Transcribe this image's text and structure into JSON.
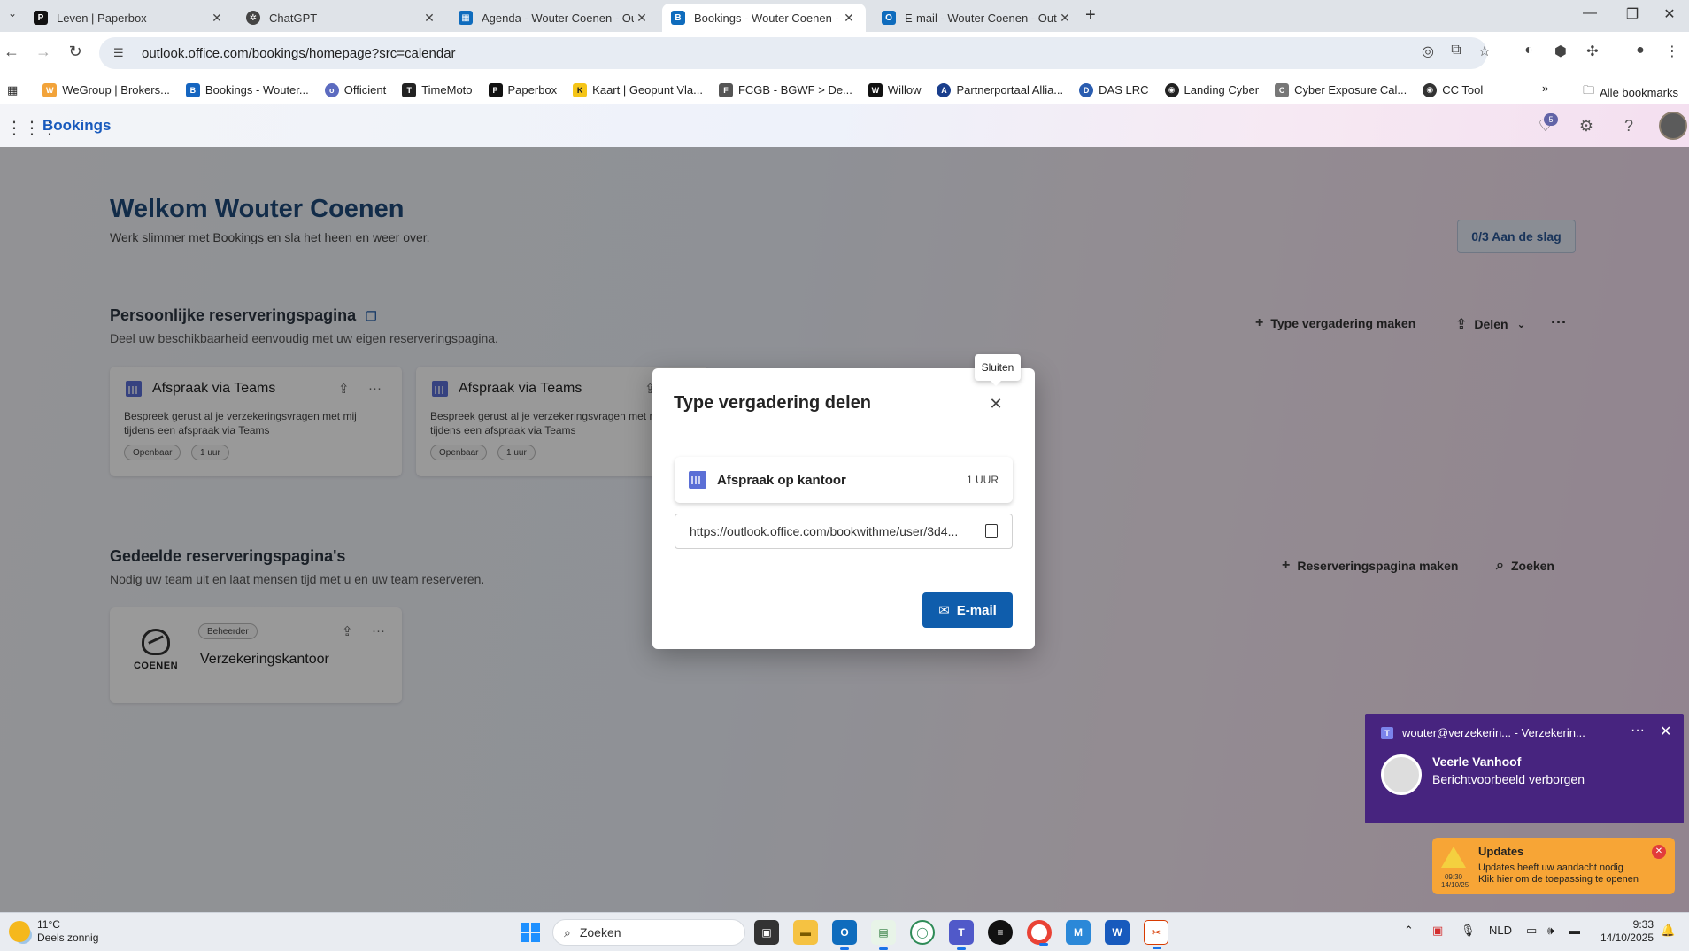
{
  "browser": {
    "tabs": [
      {
        "title": "Leven | Paperbox",
        "icon": "paperbox-icon",
        "active": false
      },
      {
        "title": "ChatGPT",
        "icon": "chatgpt-icon",
        "active": false
      },
      {
        "title": "Agenda - Wouter Coenen - Out",
        "icon": "outlook-calendar-icon",
        "active": false
      },
      {
        "title": "Bookings - Wouter Coenen - O",
        "icon": "bookings-icon",
        "active": true
      },
      {
        "title": "E-mail - Wouter Coenen - Outl",
        "icon": "outlook-mail-icon",
        "active": false
      }
    ],
    "url": "outlook.office.com/bookings/homepage?src=calendar",
    "bookmarks": [
      {
        "label": "WeGroup | Brokers...",
        "color": "#f2a33a"
      },
      {
        "label": "Bookings - Wouter...",
        "color": "#1565c0"
      },
      {
        "label": "Officient",
        "color": "#5c6bc0"
      },
      {
        "label": "TimeMoto",
        "color": "#222222"
      },
      {
        "label": "Paperbox",
        "color": "#111111"
      },
      {
        "label": "Kaart | Geopunt Vla...",
        "color": "#f5c518"
      },
      {
        "label": "FCGB - BGWF > De...",
        "color": "#555555"
      },
      {
        "label": "Willow",
        "color": "#111111"
      },
      {
        "label": "Partnerportaal Allia...",
        "color": "#1a3e8c"
      },
      {
        "label": "DAS LRC",
        "color": "#2a5db0"
      },
      {
        "label": "Landing Cyber",
        "color": "#222222"
      },
      {
        "label": "Cyber Exposure Cal...",
        "color": "#777777"
      },
      {
        "label": "CC Tool",
        "color": "#333333"
      }
    ],
    "all_bookmarks": "Alle bookmarks"
  },
  "app": {
    "name": "Bookings",
    "notification_count": "5"
  },
  "welcome": {
    "title": "Welkom Wouter Coenen",
    "subtitle": "Werk slimmer met Bookings en sla het heen en weer over.",
    "get_started": "0/3 Aan de slag"
  },
  "personal": {
    "title": "Persoonlijke reserveringspagina",
    "subtitle": "Deel uw beschikbaarheid eenvoudig met uw eigen reserveringspagina.",
    "create_label": "Type vergadering maken",
    "share_label": "Delen",
    "cards": [
      {
        "title": "Afspraak via Teams",
        "desc": "Bespreek gerust al je verzekeringsvragen met mij tijdens een afspraak via Teams",
        "visibility": "Openbaar",
        "duration": "1 uur"
      },
      {
        "title": "Afspraak via Teams",
        "desc": "Bespreek gerust al je verzekeringsvragen met mij tijdens een afspraak via Teams",
        "visibility": "Openbaar",
        "duration": "1 uur"
      }
    ]
  },
  "shared": {
    "title": "Gedeelde reserveringspagina's",
    "subtitle": "Nodig uw team uit en laat mensen tijd met u en uw team reserveren.",
    "create_label": "Reserveringspagina maken",
    "search_label": "Zoeken",
    "card": {
      "role": "Beheerder",
      "name": "Verzekeringskantoor",
      "logo_text": "COENEN"
    }
  },
  "dialog": {
    "title": "Type vergadering delen",
    "close_tooltip": "Sluiten",
    "meeting_name": "Afspraak op kantoor",
    "meeting_duration": "1 UUR",
    "url": "https://outlook.office.com/bookwithme/user/3d4...",
    "email_label": "E-mail"
  },
  "notifications": {
    "teams": {
      "header": "wouter@verzekerin... - Verzekerin...",
      "sender": "Veerle Vanhoof",
      "message": "Berichtvoorbeeld verborgen"
    },
    "updates": {
      "title": "Updates",
      "line1": "Updates heeft uw aandacht nodig",
      "line2": "Klik hier om de toepassing te openen",
      "time": "09:30",
      "date": "14/10/25"
    }
  },
  "taskbar": {
    "weather_temp": "11°C",
    "weather_desc": "Deels zonnig",
    "search_placeholder": "Zoeken",
    "language": "NLD",
    "time": "9:33",
    "date": "14/10/2025"
  }
}
